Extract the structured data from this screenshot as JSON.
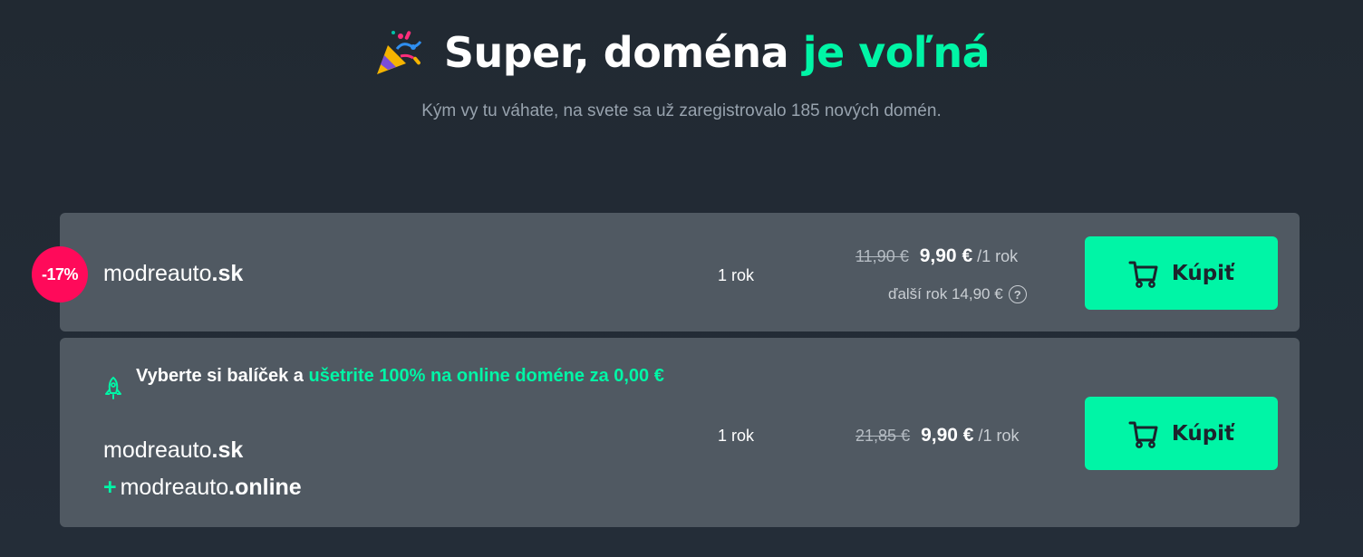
{
  "header": {
    "title_main": "Super, doména ",
    "title_accent": "je voľná",
    "subtitle": "Kým vy tu váhate, na svete sa už zaregistrovalo 185 nových domén."
  },
  "offers": [
    {
      "badge": "-17%",
      "domain_name": "modreauto",
      "domain_tld": ".sk",
      "period": "1 rok",
      "old_price": "11,90 €",
      "new_price": "9,90 €",
      "per": "/1 rok",
      "next_year": "ďalší rok 14,90 €",
      "button_label": "Kúpiť"
    },
    {
      "promo_text": "Vyberte si balíček a ",
      "promo_accent": "ušetrite 100% na online doméne za 0,00 €",
      "domain_name": "modreauto",
      "domain_tld": ".sk",
      "addon_plus": "+",
      "addon_name": "modreauto",
      "addon_tld": ".online",
      "period": "1 rok",
      "old_price": "21,85 €",
      "new_price": "9,90 €",
      "per": "/1 rok",
      "button_label": "Kúpiť"
    }
  ],
  "colors": {
    "accent": "#00f5a6",
    "badge": "#ff0a5a",
    "card": "#505962",
    "background": "#232b35"
  },
  "icons": {
    "title": "party-popper-icon",
    "help": "question-circle-icon",
    "cart": "cart-icon",
    "promo": "rocket-icon"
  }
}
